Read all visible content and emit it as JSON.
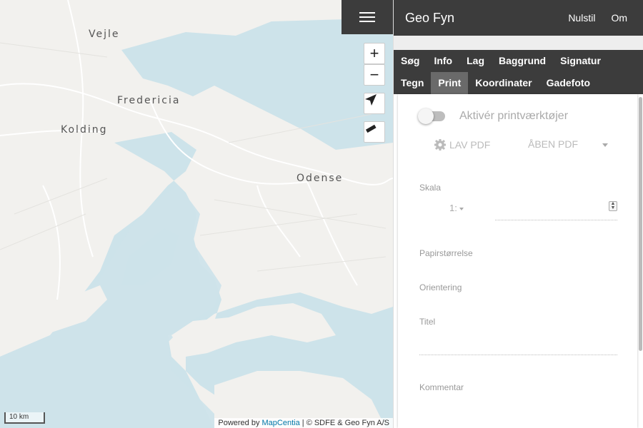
{
  "map": {
    "cities": {
      "vejle": "Vejle",
      "fredericia": "Fredericia",
      "kolding": "Kolding",
      "odense": "Odense"
    },
    "scale_label": "10 km",
    "attribution_prefix": "Powered by ",
    "attribution_link": "MapCentia",
    "attribution_suffix": " | © SDFE & Geo Fyn A/S",
    "zoom_in": "+",
    "zoom_out": "−"
  },
  "header": {
    "title": "Geo Fyn",
    "reset": "Nulstil",
    "about": "Om"
  },
  "tabs": [
    "Søg",
    "Info",
    "Lag",
    "Baggrund",
    "Signatur",
    "Tegn",
    "Print",
    "Koordinater",
    "Gadefoto"
  ],
  "print": {
    "toggle_label": "Aktivér printværktøjer",
    "make_pdf": "LAV PDF",
    "open_pdf": "ÅBEN PDF",
    "scale_label": "Skala",
    "scale_prefix": "1:",
    "paper_label": "Papirstørrelse",
    "orientation_label": "Orientering",
    "title_label": "Titel",
    "comment_label": "Kommentar"
  },
  "colors": {
    "water": "#cde3ea",
    "land": "#f2f1ee",
    "header": "#3c3c3c"
  }
}
